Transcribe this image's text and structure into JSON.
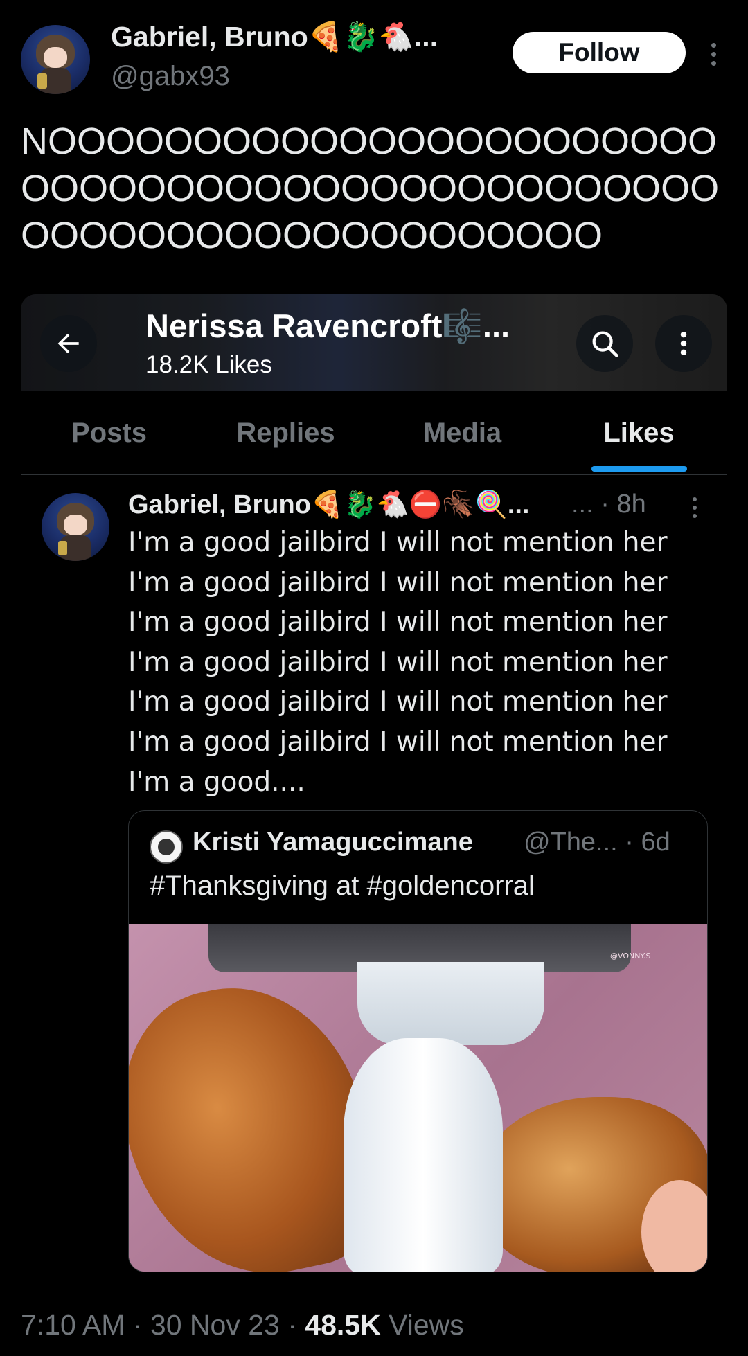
{
  "tweet": {
    "author_name": "Gabriel, Bruno🍕🐉🐔...",
    "author_handle": "@gabx93",
    "follow_label": "Follow",
    "text": "NOOOOOOOOOOOOOOOOOOOOOOOOOOOOOOOOOOOOOOOOOOOOOOOOOOOOOOOOOOOOOOOOOOO",
    "time": "7:10 AM",
    "date": "30 Nov 23",
    "views_count": "48.5K",
    "views_label": "Views",
    "separator": "·"
  },
  "screenshot": {
    "profile_name": "Nerissa Ravencroft🎼...",
    "profile_likes": "18.2K Likes",
    "tabs": [
      {
        "label": "Posts",
        "active": false
      },
      {
        "label": "Replies",
        "active": false
      },
      {
        "label": "Media",
        "active": false
      },
      {
        "label": "Likes",
        "active": true
      }
    ],
    "post": {
      "author_name": "Gabriel, Bruno🍕🐉🐔⛔🪳🍭...",
      "meta": "... · 8h",
      "lines": [
        "I'm a good jailbird I will not mention her",
        "I'm a good jailbird I will not mention her",
        "I'm a good jailbird I will not mention her",
        "I'm a good jailbird I will not mention her",
        "I'm a good jailbird I will not mention her",
        "I'm a good jailbird I will not mention her",
        "I'm a good...."
      ],
      "quote": {
        "author_name": "Kristi Yamaguccimane",
        "meta": "@The... · 6d",
        "text": "#Thanksgiving at #goldencorral",
        "watermark": "@VONNY.S"
      }
    }
  },
  "colors": {
    "background": "#000000",
    "text": "#e7e9ea",
    "muted": "#71767b",
    "accent": "#1d9bf0"
  },
  "icons": [
    "back-arrow-icon",
    "search-icon",
    "more-vertical-icon"
  ]
}
